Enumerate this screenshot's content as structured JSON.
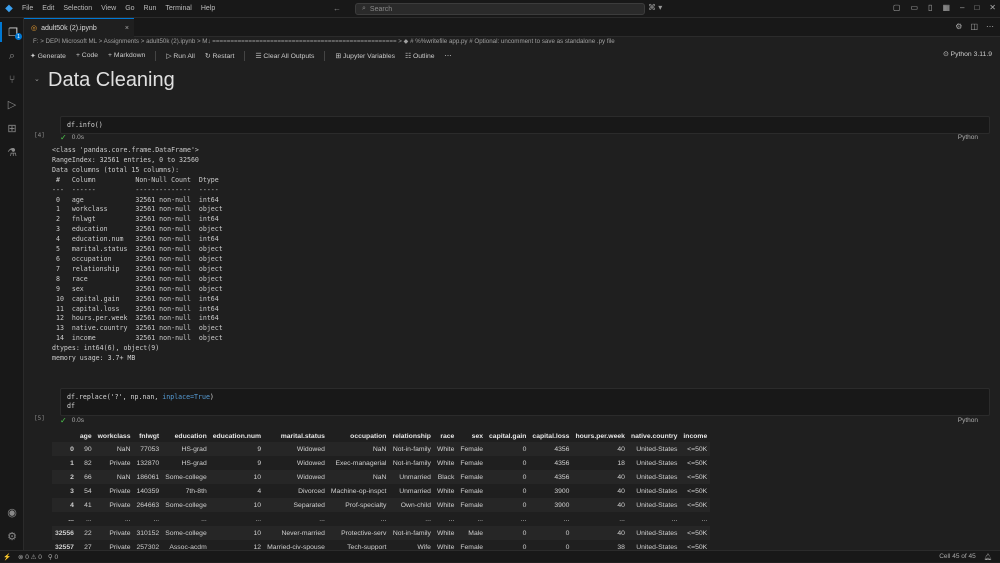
{
  "menu": [
    "File",
    "Edit",
    "Selection",
    "View",
    "Go",
    "Run",
    "Terminal",
    "Help"
  ],
  "search": {
    "placeholder": "Search"
  },
  "tab": {
    "label": "adult50k (2).ipynb",
    "close": "×"
  },
  "breadcrumb": "F: > DEPI Microsoft ML > Assignments > adult50k (2).ipynb > M↓ =================================================== > ◆ # %%writefile app.py  # Optional: uncomment to save as standalone .py file",
  "toolbar": {
    "generate": "Generate",
    "code": "+ Code",
    "markdown": "+ Markdown",
    "run_all": "▷ Run All",
    "restart": "↻ Restart",
    "clear": "☰ Clear All Outputs",
    "variables": "⊞ Jupyter Variables",
    "outline": "☷ Outline",
    "kernel": "Python 3.11.9"
  },
  "markdown_title": "Data Cleaning",
  "cell1": {
    "code": "df.info()",
    "exec": "[4]",
    "time": "0.0s",
    "lang": "Python"
  },
  "info_output": "<class 'pandas.core.frame.DataFrame'>\nRangeIndex: 32561 entries, 0 to 32560\nData columns (total 15 columns):\n #   Column          Non-Null Count  Dtype \n---  ------          --------------  ----- \n 0   age             32561 non-null  int64 \n 1   workclass       32561 non-null  object\n 2   fnlwgt          32561 non-null  int64 \n 3   education       32561 non-null  object\n 4   education.num   32561 non-null  int64 \n 5   marital.status  32561 non-null  object\n 6   occupation      32561 non-null  object\n 7   relationship    32561 non-null  object\n 8   race            32561 non-null  object\n 9   sex             32561 non-null  object\n 10  capital.gain    32561 non-null  int64 \n 11  capital.loss    32561 non-null  int64 \n 12  hours.per.week  32561 non-null  int64 \n 13  native.country  32561 non-null  object\n 14  income          32561 non-null  object\ndtypes: int64(6), object(9)\nmemory usage: 3.7+ MB",
  "cell2": {
    "line1_a": "df.replace('?', np.nan, ",
    "line1_kw": "inplace=True",
    ")": ")",
    "line2": "df",
    "exec": "[5]",
    "time": "0.0s",
    "lang": "Python"
  },
  "table": {
    "columns": [
      "",
      "age",
      "workclass",
      "fnlwgt",
      "education",
      "education.num",
      "marital.status",
      "occupation",
      "relationship",
      "race",
      "sex",
      "capital.gain",
      "capital.loss",
      "hours.per.week",
      "native.country",
      "income"
    ],
    "rows": [
      [
        "0",
        "90",
        "NaN",
        "77053",
        "HS-grad",
        "9",
        "Widowed",
        "NaN",
        "Not-in-family",
        "White",
        "Female",
        "0",
        "4356",
        "40",
        "United-States",
        "<=50K"
      ],
      [
        "1",
        "82",
        "Private",
        "132870",
        "HS-grad",
        "9",
        "Widowed",
        "Exec-managerial",
        "Not-in-family",
        "White",
        "Female",
        "0",
        "4356",
        "18",
        "United-States",
        "<=50K"
      ],
      [
        "2",
        "66",
        "NaN",
        "186061",
        "Some-college",
        "10",
        "Widowed",
        "NaN",
        "Unmarried",
        "Black",
        "Female",
        "0",
        "4356",
        "40",
        "United-States",
        "<=50K"
      ],
      [
        "3",
        "54",
        "Private",
        "140359",
        "7th-8th",
        "4",
        "Divorced",
        "Machine-op-inspct",
        "Unmarried",
        "White",
        "Female",
        "0",
        "3900",
        "40",
        "United-States",
        "<=50K"
      ],
      [
        "4",
        "41",
        "Private",
        "264663",
        "Some-college",
        "10",
        "Separated",
        "Prof-specialty",
        "Own-child",
        "White",
        "Female",
        "0",
        "3900",
        "40",
        "United-States",
        "<=50K"
      ],
      [
        "...",
        "...",
        "...",
        "...",
        "...",
        "...",
        "...",
        "...",
        "...",
        "...",
        "...",
        "...",
        "...",
        "...",
        "...",
        "..."
      ],
      [
        "32556",
        "22",
        "Private",
        "310152",
        "Some-college",
        "10",
        "Never-married",
        "Protective-serv",
        "Not-in-family",
        "White",
        "Male",
        "0",
        "0",
        "40",
        "United-States",
        "<=50K"
      ],
      [
        "32557",
        "27",
        "Private",
        "257302",
        "Assoc-acdm",
        "12",
        "Married-civ-spouse",
        "Tech-support",
        "Wife",
        "White",
        "Female",
        "0",
        "0",
        "38",
        "United-States",
        "<=50K"
      ]
    ]
  },
  "statusbar": {
    "problems": "⊗ 0 ⚠ 0",
    "cell": "Cell 45 of 45"
  }
}
